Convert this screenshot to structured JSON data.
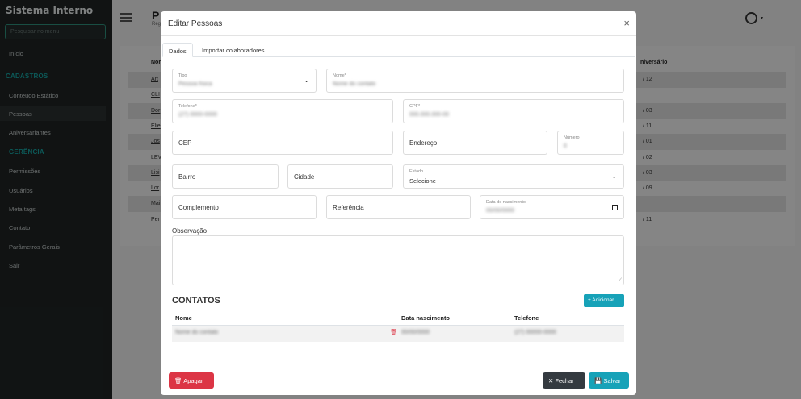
{
  "sidebar": {
    "brand": "Sistema Interno",
    "search_placeholder": "Pesquisar no menu",
    "items": {
      "inicio": "Início",
      "cadastros": "CADASTROS",
      "conteudo": "Conteúdo Estático",
      "pessoas": "Pessoas",
      "aniversariantes": "Aniversariantes",
      "gerencia": "GERÊNCIA",
      "permissoes": "Permissões",
      "usuarios": "Usuários",
      "metatags": "Meta tags",
      "contato": "Contato",
      "parametros": "Parâmetros Gerais",
      "sair": "Sair"
    }
  },
  "background": {
    "title": "P",
    "subtitle": "Reg",
    "col_nome": "Nom",
    "col_aniversario": "niversário",
    "rows": [
      {
        "name": "Art",
        "date": "/ 12"
      },
      {
        "name": "CLI",
        "date": ""
      },
      {
        "name": "Dor",
        "date": "/ 03"
      },
      {
        "name": "Elie",
        "date": "/ 11"
      },
      {
        "name": "Jos",
        "date": "/ 01"
      },
      {
        "name": "LEV",
        "date": "/ 02"
      },
      {
        "name": "Lisi",
        "date": "/ 03"
      },
      {
        "name": "Lor",
        "date": "/ 09"
      },
      {
        "name": "Mai",
        "date": ""
      },
      {
        "name": "Per",
        "date": "/ 11"
      }
    ]
  },
  "modal": {
    "title": "Editar Pessoas",
    "close_icon": "×",
    "tabs": {
      "dados": "Dados",
      "importar": "Importar colaboradores"
    },
    "fields": {
      "tipo_label": "Tipo",
      "tipo_value": "Pessoa física",
      "nome_label": "Nome*",
      "nome_value": "Nome do contato",
      "telefone_label": "Telefone*",
      "telefone_value": "(27) 0000-0000",
      "cpf_label": "CPF*",
      "cpf_value": "000.000.000-00",
      "cep": "CEP",
      "endereco": "Endereço",
      "numero_label": "Número",
      "numero_value": "0",
      "bairro": "Bairro",
      "cidade": "Cidade",
      "estado_label": "Estado",
      "estado_value": "Selecione",
      "complemento": "Complemento",
      "referencia": "Referência",
      "nascimento_label": "Data de nascimento",
      "nascimento_value": "00/00/0000",
      "observacao": "Observação"
    },
    "contatos": {
      "title": "CONTATOS",
      "add_button": "+ Adicionar",
      "col_nome": "Nome",
      "col_data": "Data nascimento",
      "col_telefone": "Telefone",
      "row": {
        "nome": "Nome do contato",
        "data": "00/00/0000",
        "telefone": "(27) 00000-0000"
      }
    },
    "footer": {
      "apagar": "🗑 Apagar",
      "fechar": "✕ Fechar",
      "salvar": "💾 Salvar"
    }
  }
}
